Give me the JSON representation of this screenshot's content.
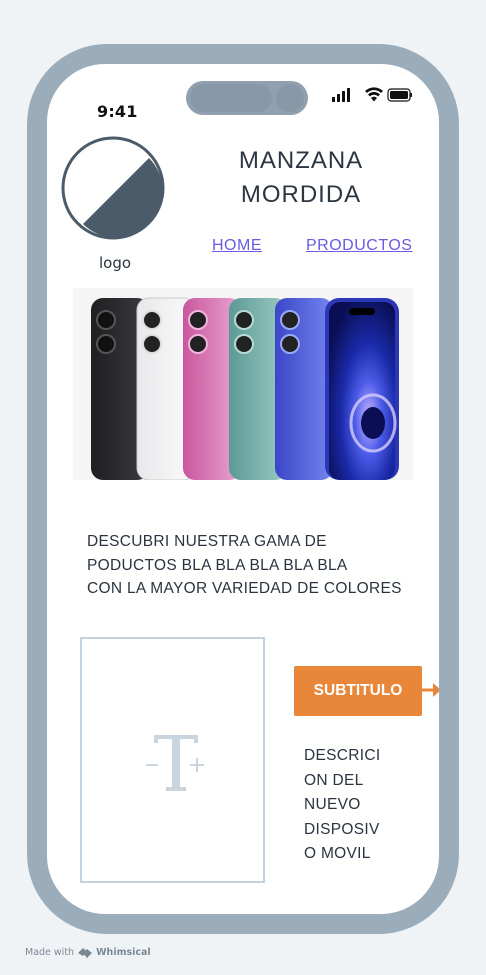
{
  "status_bar": {
    "time": "9:41"
  },
  "header": {
    "logo_label": "logo",
    "brand_line1": "MANZANA",
    "brand_line2": "MORDIDA"
  },
  "nav": {
    "home": "HOME",
    "products": "PRODUCTOS"
  },
  "hero": {
    "image": "iphone-lineup"
  },
  "description": {
    "line1": "DESCUBRI NUESTRA GAMA DE",
    "line2": "PODUCTOS BLA BLA BLA BLA BLA",
    "line3": "CON LA MAYOR VARIEDAD DE COLORES"
  },
  "feature": {
    "button_label": "SUBTITULO",
    "text_lines": [
      "DESCRICI",
      "ON DEL",
      "NUEVO",
      "DISPOSIV",
      "O MOVIL"
    ]
  },
  "footer": {
    "made_with": "Made with",
    "brand": "Whimsical"
  },
  "colors": {
    "frame": "#9bacbb",
    "accent": "#e8873a",
    "link": "#6a5be0",
    "text": "#2a3440"
  }
}
